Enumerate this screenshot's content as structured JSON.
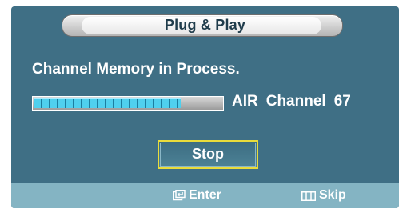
{
  "dialog": {
    "title": "Plug & Play"
  },
  "status": {
    "label": "Channel Memory in Process.",
    "progress_fraction": 0.78,
    "source": "AIR",
    "channel_label": "Channel",
    "channel_number": "67"
  },
  "actions": {
    "stop_label": "Stop"
  },
  "footer": {
    "enter_label": "Enter",
    "enter_icon": "enter-key-icon",
    "skip_label": "Skip",
    "skip_icon": "menu-key-icon"
  },
  "colors": {
    "panel": "#3f6f85",
    "footer": "#84b4c3",
    "progress": "#4fd0ee",
    "focus_border": "#e9dc3b"
  }
}
